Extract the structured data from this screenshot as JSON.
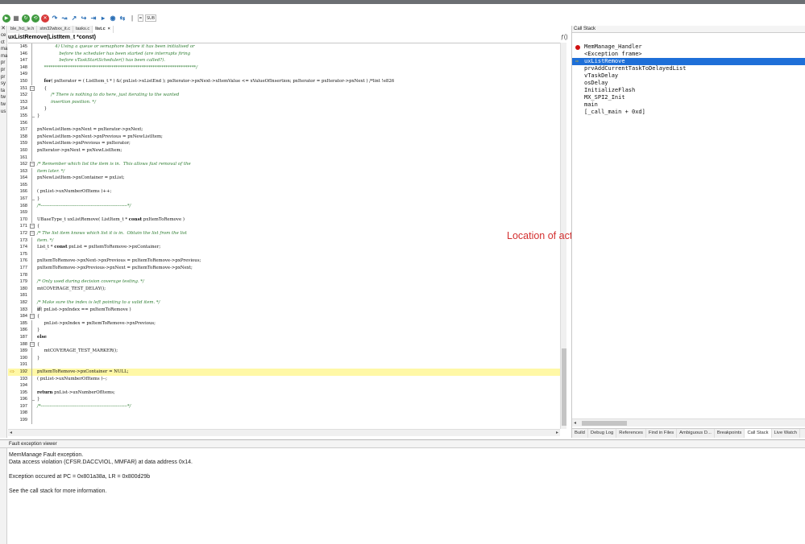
{
  "toolbar": {
    "buttons": [
      "run-icon",
      "layout-icon",
      "restart-icon",
      "reset-icon",
      "stop-icon",
      "step-into-icon",
      "step-over-icon",
      "step-out-icon",
      "step-icon",
      "run-to-icon",
      "step-instr-icon",
      "jump-icon",
      "disassembly-icon"
    ],
    "sub_label": "SUB"
  },
  "editor": {
    "tabs": [
      "ble_hci_le.h",
      "stm32wbxx_it.c",
      "tasks.c",
      "list.c"
    ],
    "active_tab": "list.c",
    "tab_close": "×",
    "function_title": "uxListRemove(ListItem_t *const)",
    "left_strip_labels": [
      "ce",
      "ct",
      "ma",
      "ma",
      "pr",
      "pr",
      "pr",
      "sy",
      "ta",
      "tw",
      "tw",
      "us"
    ],
    "lines": [
      {
        "num": "145",
        "text": "             4) Using a queue or semaphore before it has been initialised or",
        "cls": "cm"
      },
      {
        "num": "146",
        "text": "                before the scheduler has been started (are interrupts firing",
        "cls": "cm"
      },
      {
        "num": "147",
        "text": "                before vTaskStartScheduler() has been called?).",
        "cls": "cm"
      },
      {
        "num": "148",
        "text": "     **********************************************************************/",
        "cls": "cm"
      },
      {
        "num": "149",
        "text": ""
      },
      {
        "num": "150",
        "text": "     for( pxIterator = ( ListItem_t * ) &( pxList->xListEnd ); pxIterator->pxNext->xItemValue <= xValueOfInsertion; pxIterator = pxIterator->pxNext ) /*lint !e826",
        "kw": "for"
      },
      {
        "num": "151",
        "text": "     {",
        "fold": "−"
      },
      {
        "num": "152",
        "text": "          /* There is nothing to do here, just iterating to the wanted",
        "cls": "cm"
      },
      {
        "num": "153",
        "text": "          insertion position. */",
        "cls": "cm"
      },
      {
        "num": "154",
        "text": "     }"
      },
      {
        "num": "155",
        "text": "}",
        "guide": "end"
      },
      {
        "num": "156",
        "text": ""
      },
      {
        "num": "157",
        "text": "pxNewListItem->pxNext = pxIterator->pxNext;"
      },
      {
        "num": "158",
        "text": "pxNewListItem->pxNext->pxPrevious = pxNewListItem;"
      },
      {
        "num": "159",
        "text": "pxNewListItem->pxPrevious = pxIterator;"
      },
      {
        "num": "160",
        "text": "pxIterator->pxNext = pxNewListItem;"
      },
      {
        "num": "161",
        "text": ""
      },
      {
        "num": "162",
        "text": "/* Remember which list the item is in.  This allows fast removal of the",
        "cls": "cm",
        "fold": "−"
      },
      {
        "num": "163",
        "text": "item later. */",
        "cls": "cm"
      },
      {
        "num": "164",
        "text": "pxNewListItem->pxContainer = pxList;"
      },
      {
        "num": "165",
        "text": ""
      },
      {
        "num": "166",
        "text": "( pxList->uxNumberOfItems )++;"
      },
      {
        "num": "167",
        "text": "}",
        "guide": "end",
        "indent": 0
      },
      {
        "num": "168",
        "text": "/*-----------------------------------------------------------*/",
        "cls": "cm",
        "indent": 0
      },
      {
        "num": "169",
        "text": "",
        "indent": 0
      },
      {
        "num": "170",
        "text": "UBaseType_t uxListRemove( ListItem_t * const pxItemToRemove )",
        "indent": 0,
        "kw": "const"
      },
      {
        "num": "171",
        "text": "{",
        "fold": "−",
        "indent": 0
      },
      {
        "num": "172",
        "text": "/* The list item knows which list it is in.  Obtain the list from the list",
        "cls": "cm",
        "fold": "−",
        "indent": 0
      },
      {
        "num": "173",
        "text": "item. */",
        "cls": "cm",
        "indent": 0
      },
      {
        "num": "174",
        "text": "List_t * const pxList = pxItemToRemove->pxContainer;",
        "indent": 0,
        "kw": "const"
      },
      {
        "num": "175",
        "text": ""
      },
      {
        "num": "176",
        "text": "pxItemToRemove->pxNext->pxPrevious = pxItemToRemove->pxPrevious;"
      },
      {
        "num": "177",
        "text": "pxItemToRemove->pxPrevious->pxNext = pxItemToRemove->pxNext;"
      },
      {
        "num": "178",
        "text": ""
      },
      {
        "num": "179",
        "text": "/* Only used during decision coverage testing. */",
        "cls": "cm"
      },
      {
        "num": "180",
        "text": "mtCOVERAGE_TEST_DELAY();"
      },
      {
        "num": "181",
        "text": ""
      },
      {
        "num": "182",
        "text": "/* Make sure the index is left pointing to a valid item. */",
        "cls": "cm"
      },
      {
        "num": "183",
        "text": "if( pxList->pxIndex == pxItemToRemove )",
        "kw": "if"
      },
      {
        "num": "184",
        "text": "{",
        "fold": "−"
      },
      {
        "num": "185",
        "text": "     pxList->pxIndex = pxItemToRemove->pxPrevious;"
      },
      {
        "num": "186",
        "text": "}"
      },
      {
        "num": "187",
        "text": "else",
        "kw": "else"
      },
      {
        "num": "188",
        "text": "{",
        "fold": "−"
      },
      {
        "num": "189",
        "text": "     mtCOVERAGE_TEST_MARKER();"
      },
      {
        "num": "190",
        "text": "}"
      },
      {
        "num": "191",
        "text": ""
      },
      {
        "num": "192",
        "text": "pxItemToRemove->pxContainer = NULL;",
        "hl": true,
        "arrow": true
      },
      {
        "num": "193",
        "text": "( pxList->uxNumberOfItems )--;"
      },
      {
        "num": "194",
        "text": ""
      },
      {
        "num": "195",
        "text": "return pxList->uxNumberOfItems;",
        "kw": "return"
      },
      {
        "num": "196",
        "text": "}",
        "guide": "end",
        "indent": 0
      },
      {
        "num": "197",
        "text": "/*-----------------------------------------------------------*/",
        "cls": "cm",
        "indent": 0
      },
      {
        "num": "198",
        "text": "",
        "indent": 0
      },
      {
        "num": "199",
        "text": "",
        "indent": 0
      }
    ]
  },
  "annotation": "Location of actual crash .",
  "call_stack": {
    "title": "Call Stack",
    "items": [
      {
        "label": "MemManage_Handler",
        "marker": "breakpoint"
      },
      {
        "label": "<Exception frame>"
      },
      {
        "label": "uxListRemove",
        "selected": true,
        "marker": "current"
      },
      {
        "label": "prvAddCurrentTaskToDelayedList"
      },
      {
        "label": "vTaskDelay"
      },
      {
        "label": "osDelay"
      },
      {
        "label": "InitializeFlash"
      },
      {
        "label": "MX_SPI2_Init"
      },
      {
        "label": "main"
      },
      {
        "label": "[_call_main + 0xd]"
      }
    ],
    "bottom_tabs": [
      "Build",
      "Debug Log",
      "References",
      "Find in Files",
      "Ambiguous D...",
      "Breakpoints",
      "Call Stack",
      "Live Watch"
    ],
    "active_bottom_tab": "Call Stack"
  },
  "fault_viewer": {
    "title": "Fault exception viewer",
    "lines": [
      "MemManage Fault exception.",
      "Data access violation (CFSR.DACCVIOL, MMFAR) at data address 0x14.",
      "Exception occured at PC = 0x801a38a, LR = 0x800d29b",
      "See the call stack for more information."
    ]
  }
}
